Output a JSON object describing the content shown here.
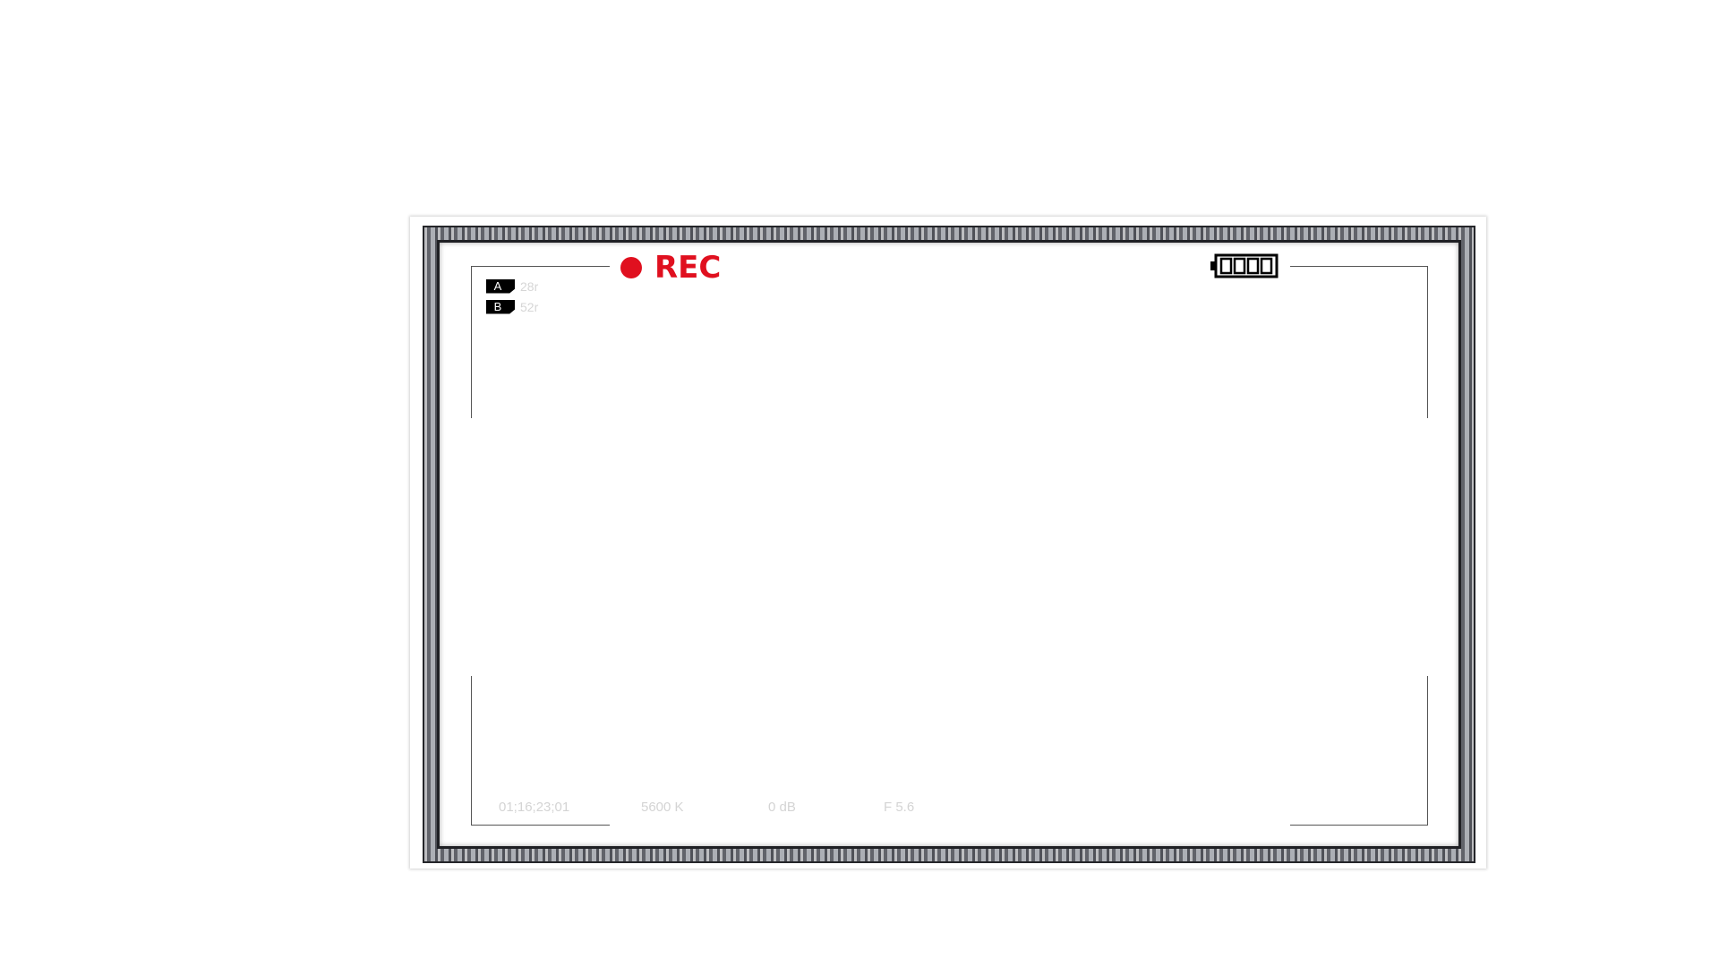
{
  "recording": {
    "label": "REC",
    "color": "#e0101f"
  },
  "battery": {
    "icon": "battery-icon",
    "level": 1.0
  },
  "media_slots": [
    {
      "slot": "A",
      "remaining": "28r"
    },
    {
      "slot": "B",
      "remaining": "52r"
    }
  ],
  "status_bar": {
    "timecode": "01;16;23;01",
    "white_balance": "5600 K",
    "gain": "0 dB",
    "aperture": "F 5.6"
  }
}
